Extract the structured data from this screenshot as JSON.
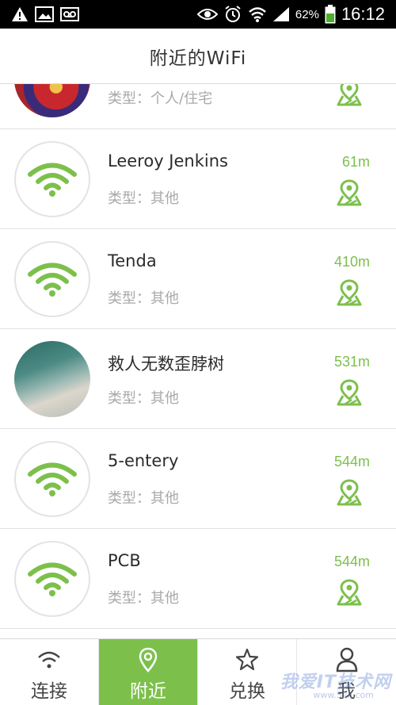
{
  "status_bar": {
    "battery_percent": "62%",
    "time": "16:12"
  },
  "header": {
    "title": "附近的WiFi"
  },
  "networks": [
    {
      "name": "",
      "type": "类型：个人/住宅",
      "distance": "",
      "avatar": "photo-red"
    },
    {
      "name": "Leeroy Jenkins",
      "type": "类型：其他",
      "distance": "61m",
      "avatar": "wifi-icon"
    },
    {
      "name": "Tenda",
      "type": "类型：其他",
      "distance": "410m",
      "avatar": "wifi-icon"
    },
    {
      "name": "救人无数歪脖树",
      "type": "类型：其他",
      "distance": "531m",
      "avatar": "photo-fish"
    },
    {
      "name": "5-entery",
      "type": "类型：其他",
      "distance": "544m",
      "avatar": "wifi-icon"
    },
    {
      "name": "PCB",
      "type": "类型：其他",
      "distance": "544m",
      "avatar": "wifi-icon"
    }
  ],
  "tabs": [
    {
      "label": "连接",
      "icon": "wifi-icon",
      "active": false
    },
    {
      "label": "附近",
      "icon": "location-pin-icon",
      "active": true
    },
    {
      "label": "兑换",
      "icon": "star-icon",
      "active": false
    },
    {
      "label": "我",
      "icon": "person-icon",
      "active": false
    }
  ],
  "watermark": {
    "text": "我爱IT技术网",
    "sub": "www.52ij.com"
  },
  "colors": {
    "accent": "#7cc04b",
    "text": "#2b2b2b",
    "muted": "#a9a9a9"
  }
}
